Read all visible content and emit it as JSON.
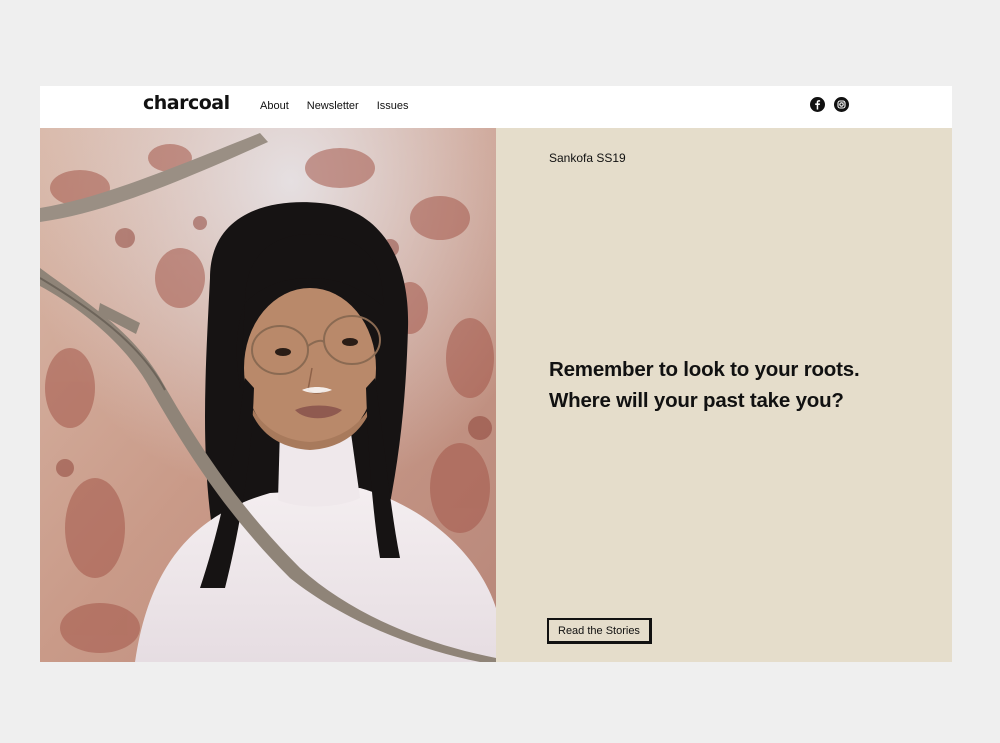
{
  "header": {
    "logo": "charcoal",
    "nav": [
      {
        "label": "About"
      },
      {
        "label": "Newsletter"
      },
      {
        "label": "Issues"
      }
    ],
    "social": [
      {
        "icon": "facebook-icon",
        "glyph": "f"
      },
      {
        "icon": "instagram-icon"
      }
    ]
  },
  "hero": {
    "image_alt": "Portrait of a woman with glasses and bangs in front of a toile backdrop with a tree branch",
    "kicker": "Sankofa SS19",
    "headline_line1": "Remember to look to your roots.",
    "headline_line2": "Where will your past take you?",
    "cta_label": "Read the Stories"
  },
  "colors": {
    "page_bg": "#efefef",
    "panel_bg": "#e5ddcb",
    "text": "#111111"
  }
}
